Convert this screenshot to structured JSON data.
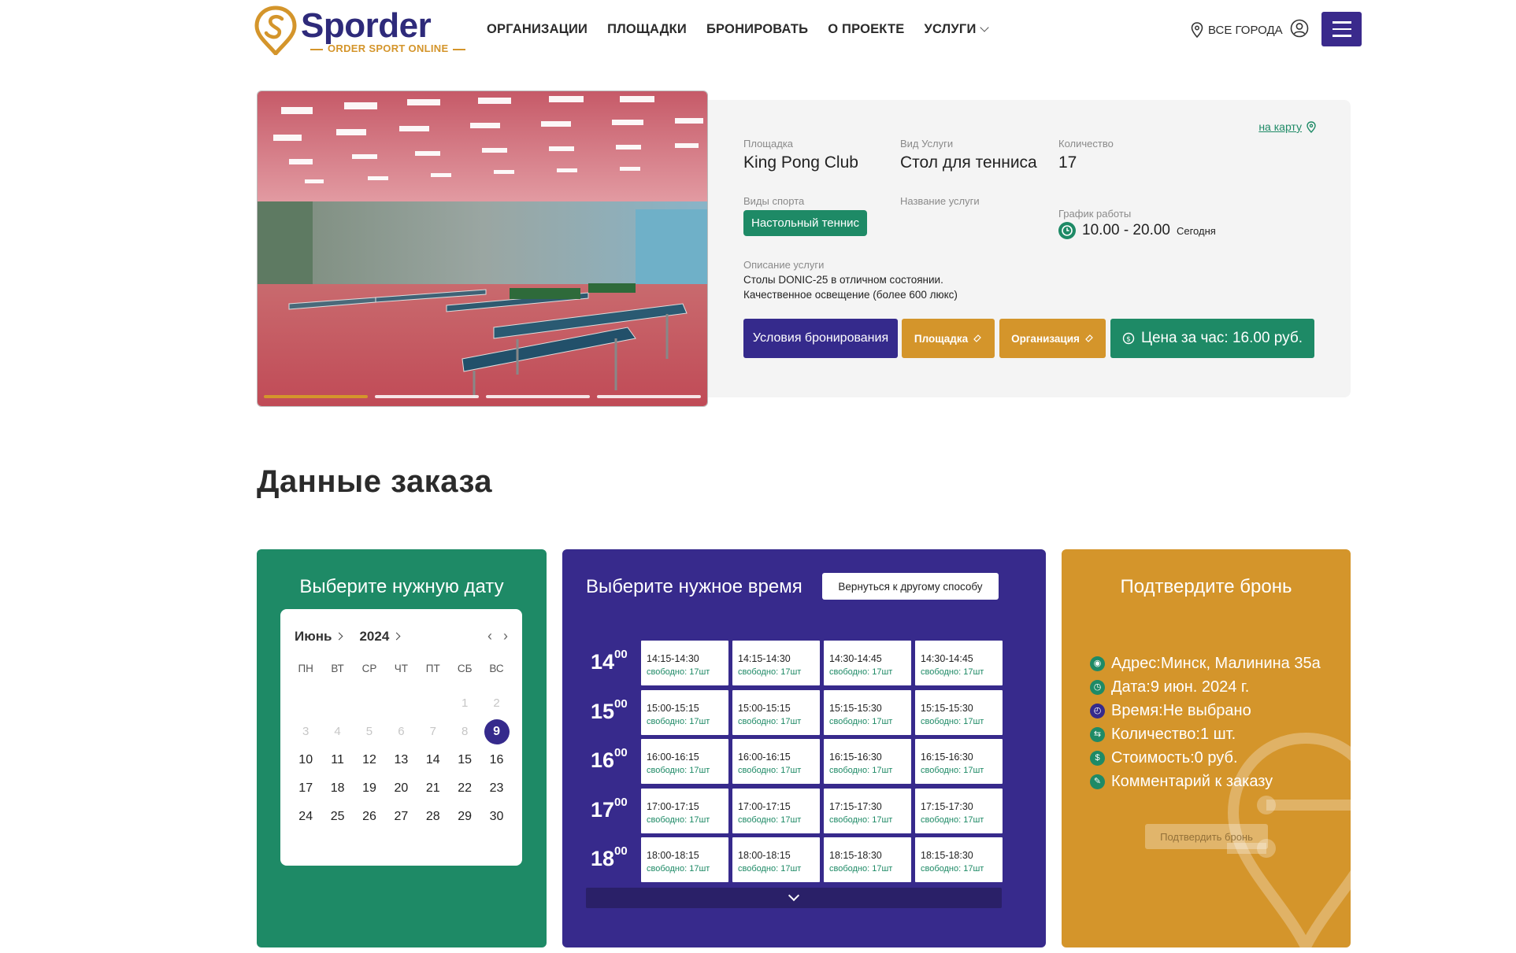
{
  "header": {
    "logo_text": "Sporder",
    "logo_tagline": "ORDER SPORT ONLINE",
    "nav": [
      "ОРГАНИЗАЦИИ",
      "ПЛОЩАДКИ",
      "БРОНИРОВАТЬ",
      "О ПРОЕКТЕ",
      "УСЛУГИ"
    ],
    "city": "ВСЕ ГОРОДА"
  },
  "venue": {
    "map_link": "на карту",
    "place_label": "Площадка",
    "place_value": "King Pong Club",
    "service_type_label": "Вид Услуги",
    "service_type_value": "Стол для тенниса",
    "quantity_label": "Количество",
    "quantity_value": "17",
    "sports_label": "Виды спорта",
    "sport_badge": "Настольный теннис",
    "service_name_label": "Название услуги",
    "schedule_label": "График работы",
    "schedule_hours": "10.00 - 20.00",
    "schedule_day": "Сегодня",
    "description_label": "Описание услуги",
    "description_line1": "Столы DONIC-25 в отличном состоянии.",
    "description_line2": "Качественное освещение (более 600 люкс)",
    "btn_conditions": "Условия бронирования",
    "btn_place": "Площадка",
    "btn_org": "Организация",
    "btn_price": "Цена за час: 16.00 руб.",
    "gallery_active_index": 0,
    "gallery_count": 4
  },
  "order": {
    "title": "Данные заказа"
  },
  "date_panel": {
    "title": "Выберите нужную дату",
    "month": "Июнь",
    "year": "2024",
    "weekdays": [
      "ПН",
      "ВТ",
      "СР",
      "ЧТ",
      "ПТ",
      "СБ",
      "ВС"
    ],
    "selected_day": 9
  },
  "time_panel": {
    "title": "Выберите нужное время",
    "back_button": "Вернуться к другому способу",
    "rows": [
      {
        "hour": "14",
        "min": "00",
        "slots": [
          {
            "time": "14:15-14:30",
            "free": "свободно: 17шт"
          },
          {
            "time": "14:15-14:30",
            "free": "свободно: 17шт"
          },
          {
            "time": "14:30-14:45",
            "free": "свободно: 17шт"
          },
          {
            "time": "14:30-14:45",
            "free": "свободно: 17шт"
          }
        ]
      },
      {
        "hour": "15",
        "min": "00",
        "slots": [
          {
            "time": "15:00-15:15",
            "free": "свободно: 17шт"
          },
          {
            "time": "15:00-15:15",
            "free": "свободно: 17шт"
          },
          {
            "time": "15:15-15:30",
            "free": "свободно: 17шт"
          },
          {
            "time": "15:15-15:30",
            "free": "свободно: 17шт"
          }
        ]
      },
      {
        "hour": "16",
        "min": "00",
        "slots": [
          {
            "time": "16:00-16:15",
            "free": "свободно: 17шт"
          },
          {
            "time": "16:00-16:15",
            "free": "свободно: 17шт"
          },
          {
            "time": "16:15-16:30",
            "free": "свободно: 17шт"
          },
          {
            "time": "16:15-16:30",
            "free": "свободно: 17шт"
          }
        ]
      },
      {
        "hour": "17",
        "min": "00",
        "slots": [
          {
            "time": "17:00-17:15",
            "free": "свободно: 17шт"
          },
          {
            "time": "17:00-17:15",
            "free": "свободно: 17шт"
          },
          {
            "time": "17:15-17:30",
            "free": "свободно: 17шт"
          },
          {
            "time": "17:15-17:30",
            "free": "свободно: 17шт"
          }
        ]
      },
      {
        "hour": "18",
        "min": "00",
        "slots": [
          {
            "time": "18:00-18:15",
            "free": "свободно: 17шт"
          },
          {
            "time": "18:00-18:15",
            "free": "свободно: 17шт"
          },
          {
            "time": "18:15-18:30",
            "free": "свободно: 17шт"
          },
          {
            "time": "18:15-18:30",
            "free": "свободно: 17шт"
          }
        ]
      }
    ]
  },
  "confirm_panel": {
    "title": "Подтвердите бронь",
    "items": [
      {
        "icon": "pin-icon",
        "text": "Адрес:Минск, Малинина 35а"
      },
      {
        "icon": "clock-icon",
        "text": "Дата:9 июн. 2024 г."
      },
      {
        "icon": "time-icon",
        "text": "Время:Не выбрано"
      },
      {
        "icon": "quantity-icon",
        "text": "Количество:1 шт."
      },
      {
        "icon": "price-icon",
        "text": "Стоимость:0 руб."
      },
      {
        "icon": "comment-icon",
        "text": "Комментарий к заказу"
      }
    ],
    "confirm_button": "Подтвердить бронь"
  },
  "colors": {
    "primary_violet": "#352a8c",
    "green": "#1e8a66",
    "gold": "#d4952b"
  }
}
